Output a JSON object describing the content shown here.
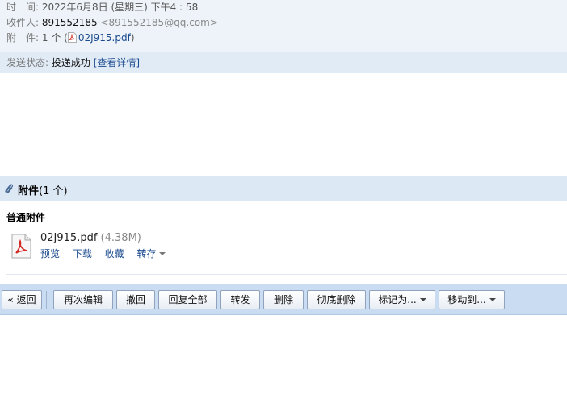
{
  "header": {
    "time_label": "时　间:",
    "time_value": "2022年6月8日 (星期三) 下午4 : 58",
    "recipient_label": "收件人:",
    "recipient_name": "891552185",
    "recipient_email": "<891552185@qq.com>",
    "attachment_label": "附　件:",
    "attachment_count_text": "1 个 (",
    "attachment_file": "02J915.pdf",
    "attachment_close": ")"
  },
  "status": {
    "label": "发送状态:",
    "value": "投递成功",
    "details_link": "[查看详情]"
  },
  "attachments": {
    "title": "附件",
    "count": "(1 个)",
    "section_title": "普通附件",
    "file": {
      "name": "02J915.pdf",
      "size": "(4.38M)",
      "actions": [
        "预览",
        "下载",
        "收藏",
        "转存"
      ]
    }
  },
  "toolbar": {
    "back": "« 返回",
    "edit_again": "再次编辑",
    "recall": "撤回",
    "reply_all": "回复全部",
    "forward": "转发",
    "delete": "删除",
    "delete_permanently": "彻底删除",
    "mark_as": "标记为...",
    "move_to": "移动到..."
  },
  "icons": {
    "pdf": "pdf-file-icon",
    "clip": "paperclip-icon",
    "dropdown": "caret-down-icon"
  },
  "colors": {
    "header_bg": "#eef3f9",
    "status_bg": "#e1ebf6",
    "toolbar_bg": "#c9dcf1",
    "link": "#1a4a8e"
  }
}
